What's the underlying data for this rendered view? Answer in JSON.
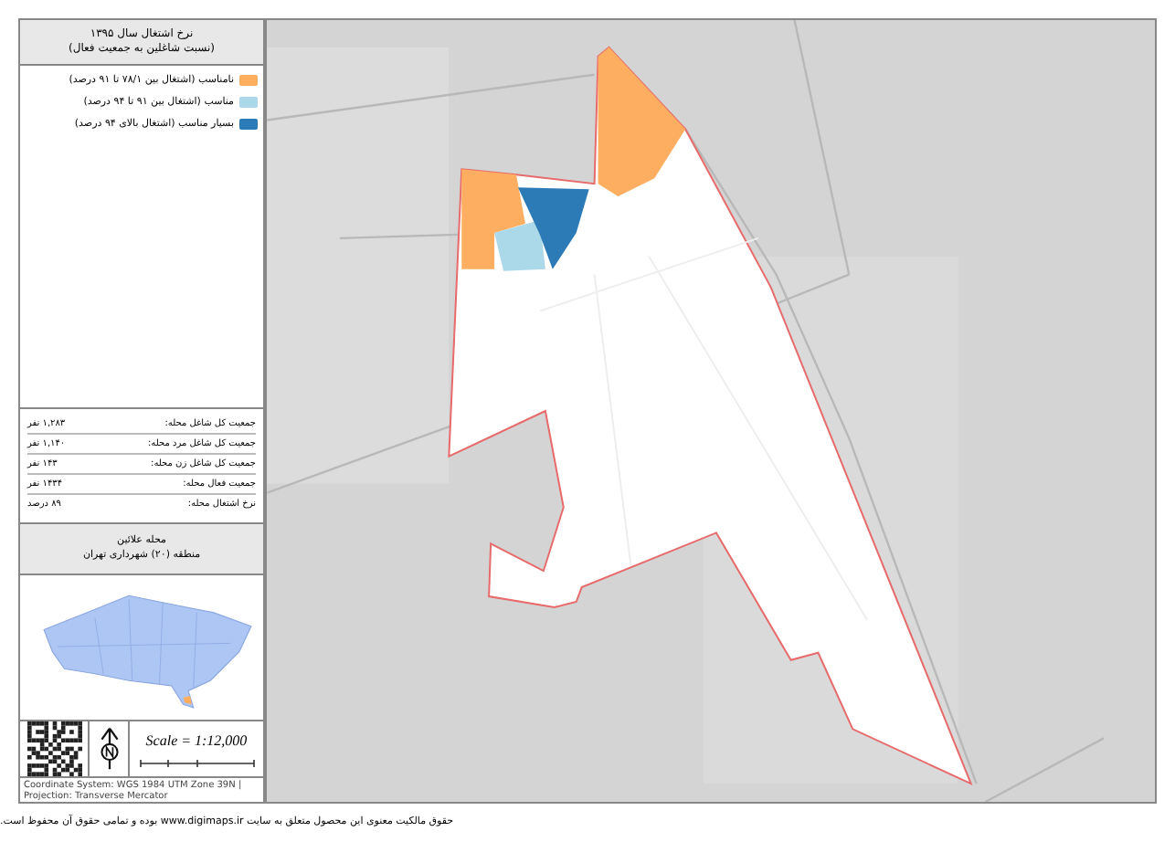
{
  "legend": {
    "title": "نرخ اشتغال سال ۱۳۹۵",
    "subtitle": "(نسبت شاغلین به جمعیت فعال)",
    "items": [
      {
        "label": "نامناسب (اشتغال بین ۷۸/۱ تا ۹۱ درصد)",
        "color": "#fdae61"
      },
      {
        "label": "مناسب (اشتغال بین ۹۱ تا ۹۴ درصد)",
        "color": "#abd9e9"
      },
      {
        "label": "بسیار مناسب (اشتغال بالای ۹۴ درصد)",
        "color": "#2c7bb6"
      }
    ]
  },
  "stats": [
    {
      "label": "جمعیت کل شاغل محله:",
      "value": "۱,۲۸۳ نفر"
    },
    {
      "label": "جمعیت کل شاغل مرد محله:",
      "value": "۱,۱۴۰ نفر"
    },
    {
      "label": "جمعیت کل شاغل زن محله:",
      "value": "۱۴۳ نفر"
    },
    {
      "label": "جمعیت فعال محله:",
      "value": "۱۴۳۴ نفر"
    },
    {
      "label": "نرخ اشتغال محله:",
      "value": "۸۹ درصد"
    }
  ],
  "locator": {
    "title": "محله علائین",
    "subtitle": "منطقه (۲۰) شهرداری تهران"
  },
  "scale": "Scale = 1:12,000",
  "credits": "Coordinate System: WGS 1984 UTM Zone 39N | Projection: Transverse Mercator",
  "footer": "حقوق مالکیت معنوی این محصول متعلق به سایت www.digimaps.ir بوده و تمامی حقوق آن محفوظ است."
}
